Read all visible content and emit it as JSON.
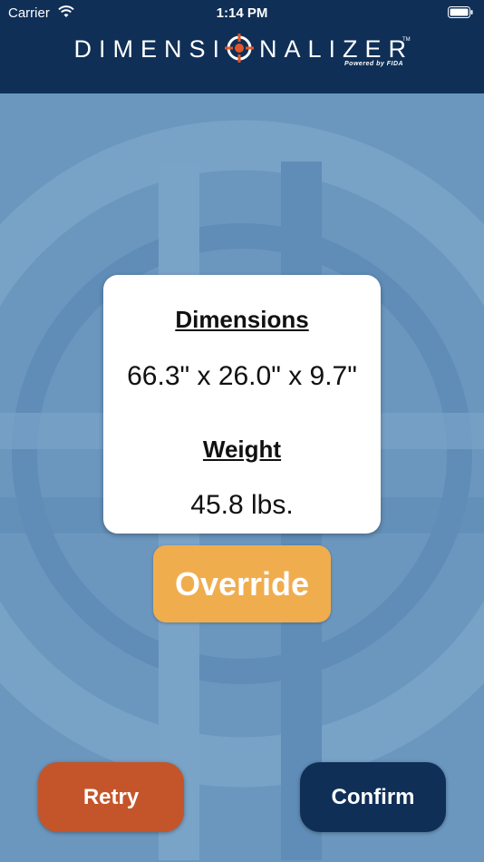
{
  "status_bar": {
    "carrier": "Carrier",
    "time": "1:14 PM",
    "wifi_icon": "wifi-icon",
    "battery_icon": "battery-icon"
  },
  "header": {
    "logo_left": "DIMENSI",
    "logo_right": "NALIZER",
    "logo_tm": "TM",
    "logo_subtitle": "Powered by FIDA",
    "logo_icon": "crosshair-target-icon"
  },
  "card": {
    "dimensions_title": "Dimensions",
    "dimensions_value": "66.3\" x  26.0\"  x 9.7\"",
    "weight_title": "Weight",
    "weight_value": "45.8 lbs."
  },
  "buttons": {
    "override": "Override",
    "retry": "Retry",
    "confirm": "Confirm"
  },
  "colors": {
    "header_bg": "#0f2f57",
    "page_bg": "#6b97bf",
    "override": "#f0ad4e",
    "retry": "#c4552a",
    "confirm": "#0f2f57"
  }
}
